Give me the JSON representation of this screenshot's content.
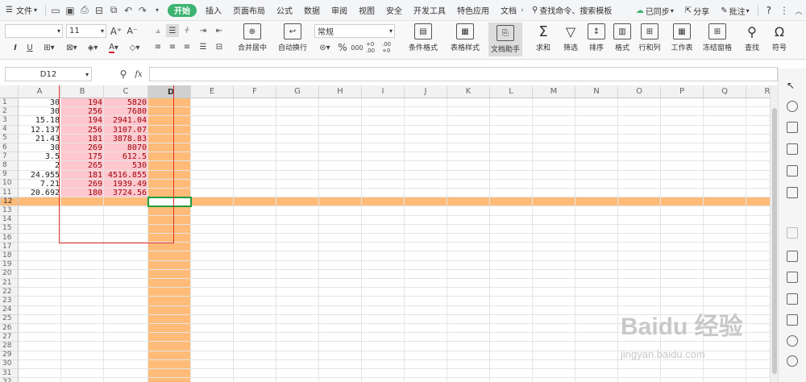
{
  "menubar": {
    "menu_label": "文件",
    "tabs": [
      "开始",
      "插入",
      "页面布局",
      "公式",
      "数据",
      "审阅",
      "视图",
      "安全",
      "开发工具",
      "特色应用",
      "文档"
    ],
    "search": "查找命令、搜索模板",
    "sync": "已同步",
    "share": "分享",
    "annotate": "批注",
    "help": "?"
  },
  "toolbar": {
    "font_name": "",
    "font_size": "11",
    "number_format": "常规",
    "merge_label": "合并居中",
    "wrap_label": "自动换行",
    "cond_format": "条件格式",
    "table_style": "表格样式",
    "doc_helper": "文档助手",
    "sum": "求和",
    "filter": "筛选",
    "sort": "排序",
    "format": "格式",
    "rowcol": "行和列",
    "worksheet": "工作表",
    "freeze": "冻结窗格",
    "find": "查找",
    "symbol": "符号",
    "percent": "%",
    "thousands": "000",
    "inc_dec": "+0 .00",
    "dec_dec": ".00 +0"
  },
  "formula": {
    "name_box": "D12",
    "fx": "fx",
    "content": ""
  },
  "grid": {
    "columns": [
      "A",
      "B",
      "C",
      "D",
      "E",
      "F",
      "G",
      "H",
      "I",
      "J",
      "K",
      "L",
      "M",
      "N",
      "O",
      "P",
      "Q",
      "R"
    ],
    "rows": [
      "1",
      "2",
      "3",
      "4",
      "5",
      "6",
      "7",
      "8",
      "9",
      "10",
      "11",
      "12",
      "13",
      "14",
      "15",
      "16",
      "17",
      "18",
      "19",
      "20",
      "21",
      "22",
      "23",
      "24",
      "25",
      "26",
      "27",
      "28",
      "29",
      "30",
      "31",
      "32"
    ],
    "col_a": [
      "30",
      "30",
      "15.18",
      "12.137",
      "21.43",
      "30",
      "3.5",
      "2",
      "24.955",
      "7.21",
      "20.692"
    ],
    "col_b": [
      "194",
      "256",
      "194",
      "256",
      "181",
      "269",
      "175",
      "265",
      "181",
      "269",
      "180"
    ],
    "col_c": [
      "5820",
      "7680",
      "2941.04",
      "3107.07",
      "3878.83",
      "8070",
      "612.5",
      "530",
      "4516.855",
      "1939.49",
      "3724.56"
    ]
  },
  "colors": {
    "pink_fill": "#ffc7ce",
    "red_text": "#9c0006",
    "selection_orange": "#ffbb77",
    "accent_green": "#3cb371"
  },
  "watermark": {
    "main": "Baidu 经验",
    "sub": "jingyan.baidu.com"
  }
}
